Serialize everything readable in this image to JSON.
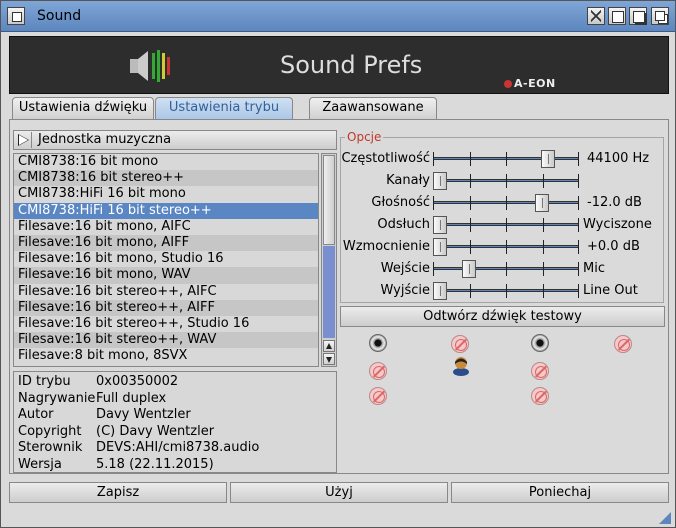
{
  "window": {
    "title": "Sound"
  },
  "banner": {
    "title": "Sound Prefs",
    "brand": "A-EON"
  },
  "tabs": [
    {
      "label": "Ustawienia dźwięku",
      "active": false
    },
    {
      "label": "Ustawienia trybu",
      "active": true
    },
    {
      "label": "Zaawansowane",
      "active": false
    }
  ],
  "unit": {
    "label": "Jednostka muzyczna"
  },
  "modes": [
    "CMI8738:16 bit mono",
    "CMI8738:16 bit stereo++",
    "CMI8738:HiFi 16 bit mono",
    "CMI8738:HiFi 16 bit stereo++",
    "Filesave:16 bit mono, AIFC",
    "Filesave:16 bit mono, AIFF",
    "Filesave:16 bit mono, Studio 16",
    "Filesave:16 bit mono, WAV",
    "Filesave:16 bit stereo++, AIFC",
    "Filesave:16 bit stereo++, AIFF",
    "Filesave:16 bit stereo++, Studio 16",
    "Filesave:16 bit stereo++, WAV",
    "Filesave:8 bit mono, 8SVX"
  ],
  "selected_mode_index": 3,
  "info": {
    "mode_id": {
      "key": "ID trybu",
      "value": "0x00350002"
    },
    "recording": {
      "key": "Nagrywanie",
      "value": "Full duplex"
    },
    "author": {
      "key": "Autor",
      "value": "Davy Wentzler"
    },
    "copyright": {
      "key": "Copyright",
      "value": "(C) Davy Wentzler"
    },
    "driver": {
      "key": "Sterownik",
      "value": "DEVS:AHI/cmi8738.audio"
    },
    "version": {
      "key": "Wersja",
      "value": "5.18 (22.11.2015)"
    }
  },
  "options": {
    "legend": "Opcje",
    "frequency": {
      "label": "Częstotliwość",
      "value": "44100 Hz",
      "level": 0.82
    },
    "channels": {
      "label": "Kanały",
      "value": "",
      "level": 0.0
    },
    "volume": {
      "label": "Głośność",
      "value": "-12.0 dB",
      "level": 0.77
    },
    "monitor": {
      "label": "Odsłuch",
      "value": "Wyciszone",
      "level": 0.0
    },
    "gain": {
      "label": "Wzmocnienie",
      "value": "+0.0 dB",
      "level": 0.0
    },
    "input": {
      "label": "Wejście",
      "value": "Mic",
      "level": 0.22
    },
    "output": {
      "label": "Wyjście",
      "value": "Line Out",
      "level": 0.0
    }
  },
  "test_button": {
    "label": "Odtwórz dźwięk testowy"
  },
  "buttons": {
    "save": "Zapisz",
    "use": "Użyj",
    "cancel": "Poniechaj"
  }
}
